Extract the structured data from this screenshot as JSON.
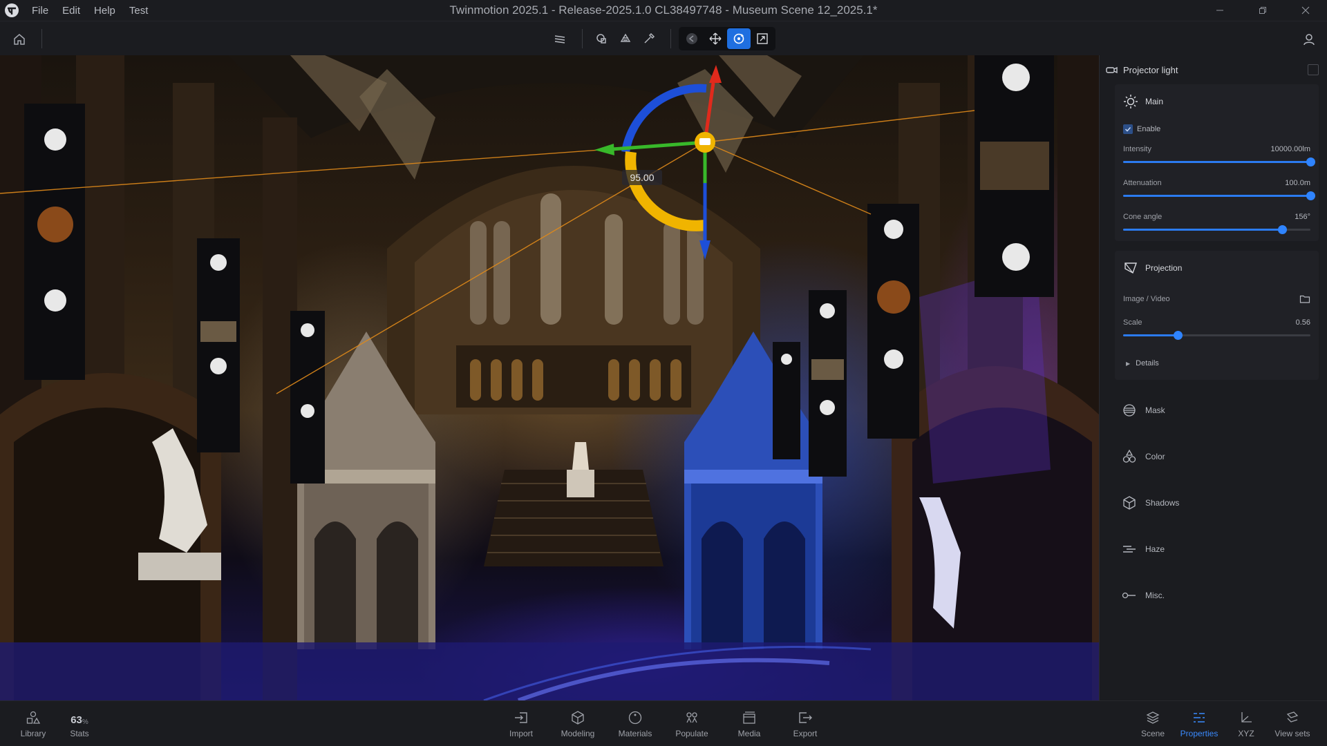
{
  "app": {
    "window_title": "Twinmotion 2025.1 - Release-2025.1.0 CL38497748 - Museum Scene 12_2025.1*",
    "menu": [
      "File",
      "Edit",
      "Help",
      "Test"
    ]
  },
  "toolbar": {
    "tools": [
      "layers-icon",
      "shape-select-icon",
      "lasso-select-icon",
      "eyedropper-icon"
    ],
    "transform": [
      "back-arrow-icon",
      "move-icon",
      "rotate-icon",
      "scale-icon"
    ],
    "active_transform": "rotate-icon"
  },
  "viewport": {
    "gizmo_value": "95.00"
  },
  "panel": {
    "title": "Projector light",
    "main": {
      "title": "Main",
      "enable_label": "Enable",
      "enabled": true,
      "sliders": [
        {
          "label": "Intensity",
          "value": "10000.00lm",
          "level": 1.0
        },
        {
          "label": "Attenuation",
          "value": "100.0m",
          "level": 1.0
        },
        {
          "label": "Cone angle",
          "value": "156°",
          "level": 0.85
        }
      ]
    },
    "projection": {
      "title": "Projection",
      "image_label": "Image / Video",
      "scale_label": "Scale",
      "scale_value": "0.56",
      "scale_level": 0.29,
      "details_label": "Details"
    },
    "sections": [
      {
        "label": "Mask",
        "icon": "mask-icon"
      },
      {
        "label": "Color",
        "icon": "color-icon"
      },
      {
        "label": "Shadows",
        "icon": "shadows-icon"
      },
      {
        "label": "Haze",
        "icon": "haze-icon"
      },
      {
        "label": "Misc.",
        "icon": "misc-icon"
      }
    ]
  },
  "bottom": {
    "library": "Library",
    "stats_value": "63",
    "stats_unit": "%",
    "stats_label": "Stats",
    "center": [
      "Import",
      "Modeling",
      "Materials",
      "Populate",
      "Media",
      "Export"
    ],
    "right": [
      "Scene",
      "Properties",
      "XYZ",
      "View sets"
    ],
    "active": "Properties"
  },
  "colors": {
    "accent": "#1f6fe0",
    "panel_bg": "#1b1c20",
    "gizmo_red": "#e02a1c",
    "gizmo_green": "#38b82a",
    "gizmo_blue": "#1d4fd8",
    "gizmo_yellow": "#f0b400"
  }
}
